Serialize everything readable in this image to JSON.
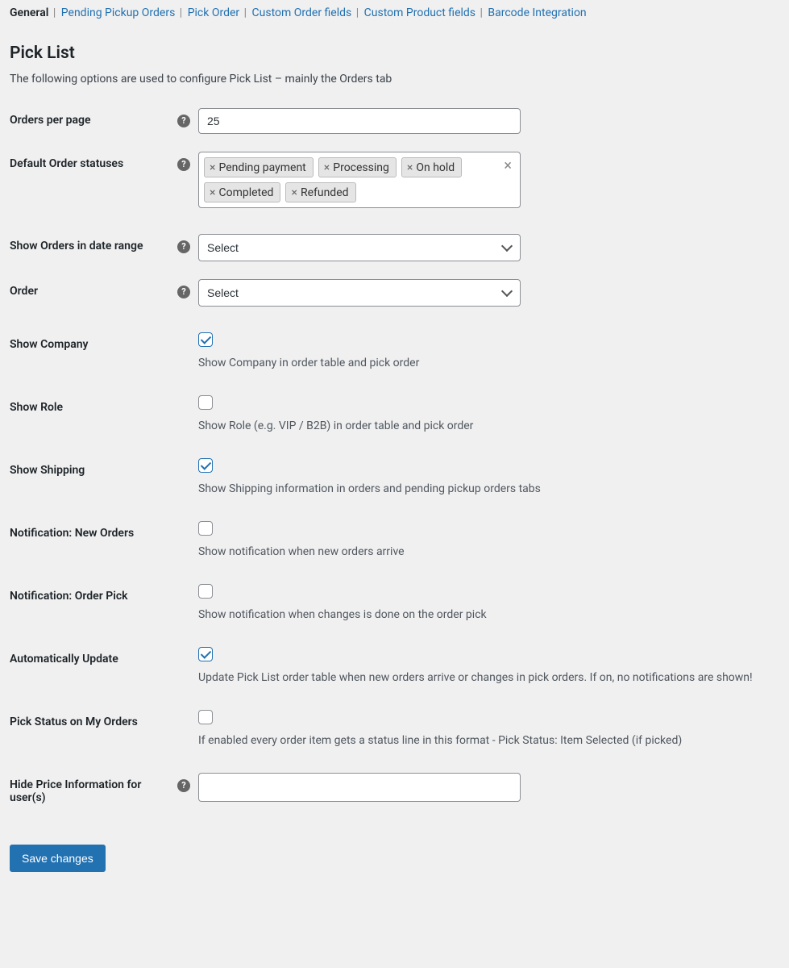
{
  "tabs": {
    "items": [
      {
        "label": "General",
        "active": true
      },
      {
        "label": "Pending Pickup Orders",
        "active": false
      },
      {
        "label": "Pick Order",
        "active": false
      },
      {
        "label": "Custom Order fields",
        "active": false
      },
      {
        "label": "Custom Product fields",
        "active": false
      },
      {
        "label": "Barcode Integration",
        "active": false
      }
    ]
  },
  "page": {
    "title": "Pick List",
    "description": "The following options are used to configure Pick List – mainly the Orders tab"
  },
  "form": {
    "ordersPerPage": {
      "label": "Orders per page",
      "value": "25",
      "help": true
    },
    "defaultStatuses": {
      "label": "Default Order statuses",
      "help": true,
      "tags": [
        "Pending payment",
        "Processing",
        "On hold",
        "Completed",
        "Refunded"
      ]
    },
    "dateRange": {
      "label": "Show Orders in date range",
      "help": true,
      "value": "Select"
    },
    "order": {
      "label": "Order",
      "help": true,
      "value": "Select"
    },
    "showCompany": {
      "label": "Show Company",
      "checked": true,
      "description": "Show Company in order table and pick order"
    },
    "showRole": {
      "label": "Show Role",
      "checked": false,
      "description": "Show Role (e.g. VIP / B2B) in order table and pick order"
    },
    "showShipping": {
      "label": "Show Shipping",
      "checked": true,
      "description": "Show Shipping information in orders and pending pickup orders tabs"
    },
    "notifNewOrders": {
      "label": "Notification: New Orders",
      "checked": false,
      "description": "Show notification when new orders arrive"
    },
    "notifOrderPick": {
      "label": "Notification: Order Pick",
      "checked": false,
      "description": "Show notification when changes is done on the order pick"
    },
    "autoUpdate": {
      "label": "Automatically Update",
      "checked": true,
      "description": "Update Pick List order table when new orders arrive or changes in pick orders. If on, no notifications are shown!"
    },
    "pickStatus": {
      "label": "Pick Status on My Orders",
      "checked": false,
      "description": "If enabled every order item gets a status line in this format - Pick Status: Item Selected (if picked)"
    },
    "hidePrice": {
      "label": "Hide Price Information for user(s)",
      "help": true,
      "value": ""
    }
  },
  "actions": {
    "save": "Save changes"
  }
}
